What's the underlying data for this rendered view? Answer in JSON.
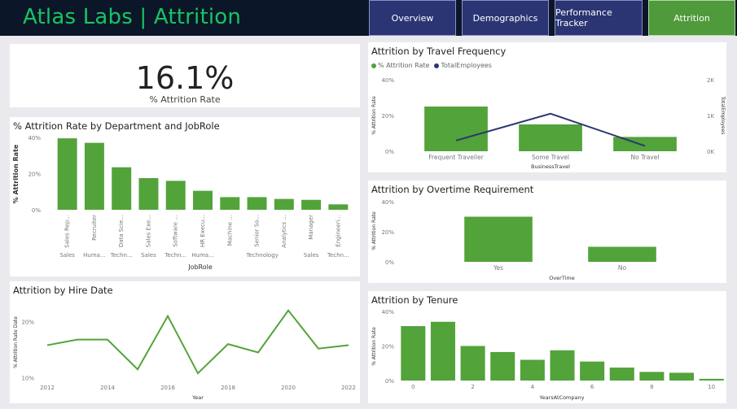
{
  "header": {
    "title": "Atlas Labs | Attrition",
    "nav": [
      {
        "label": "Overview",
        "active": false
      },
      {
        "label": "Demographics",
        "active": false
      },
      {
        "label": "Performance Tracker",
        "active": false
      },
      {
        "label": "Attrition",
        "active": true
      }
    ]
  },
  "kpi": {
    "value": "16.1%",
    "label": "% Attrition Rate"
  },
  "colors": {
    "bar": "#52a33a",
    "line_secondary": "#2c3670",
    "header_bg": "#0b1628",
    "title": "#17c462"
  },
  "dept_chart": {
    "title": "% Attrition Rate by Department and JobRole",
    "chart_data": {
      "type": "bar",
      "categories": [
        "Sales Rep...",
        "Recruiter",
        "Data Scie...",
        "Sales Exe...",
        "Software ...",
        "HR Execu...",
        "Machine ...",
        "Senior So...",
        "Analytics ...",
        "Manager",
        "Engineeri..."
      ],
      "departments": [
        "Sales",
        "Huma...",
        "Techn...",
        "Sales",
        "Techn...",
        "Huma...",
        "",
        "Technology",
        "",
        "Sales",
        "Techn..."
      ],
      "values": [
        39.5,
        37,
        23.5,
        17.5,
        16,
        10.5,
        7,
        7,
        6,
        5.5,
        3
      ],
      "ylabel": "% Attrition Rate",
      "xlabel": "JobRole",
      "yticks": [
        "0%",
        "20%",
        "40%"
      ],
      "ylim": [
        0,
        40
      ]
    }
  },
  "hire_chart": {
    "title": "Attrition by Hire Date",
    "chart_data": {
      "type": "line",
      "x": [
        2012,
        2013,
        2014,
        2015,
        2016,
        2017,
        2018,
        2019,
        2020,
        2021,
        2022
      ],
      "values": [
        15.8,
        16.8,
        16.8,
        11.5,
        21,
        10.8,
        16,
        14.5,
        22,
        15.2,
        15.8
      ],
      "ylabel": "% Attrition Rate Date",
      "xlabel": "Year",
      "xticks": [
        "2012",
        "2014",
        "2016",
        "2018",
        "2020",
        "2022"
      ],
      "yticks": [
        "10%",
        "20%"
      ],
      "ylim": [
        9.5,
        24
      ]
    }
  },
  "travel_chart": {
    "title": "Attrition by Travel Frequency",
    "legend": [
      {
        "label": "% Attrition Rate",
        "color": "#52a33a"
      },
      {
        "label": "TotalEmployees",
        "color": "#2c3670"
      }
    ],
    "chart_data": {
      "type": "bar",
      "categories": [
        "Frequent Traveller",
        "Some Travel",
        "No Travel"
      ],
      "series": [
        {
          "name": "% Attrition Rate",
          "values": [
            25,
            15,
            8
          ]
        },
        {
          "name": "TotalEmployees",
          "values": [
            300,
            1050,
            150
          ]
        }
      ],
      "ylabel": "% Attrition Rate",
      "y2label": "TotalEmployees",
      "xlabel": "BusinessTravel",
      "yticks": [
        "0%",
        "20%",
        "40%"
      ],
      "y2ticks": [
        "0K",
        "1K",
        "2K"
      ],
      "ylim": [
        0,
        40
      ],
      "y2lim": [
        0,
        2000
      ]
    }
  },
  "overtime_chart": {
    "title": "Attrition by Overtime Requirement",
    "chart_data": {
      "type": "bar",
      "categories": [
        "Yes",
        "No"
      ],
      "values": [
        30,
        10
      ],
      "ylabel": "% Attrition Rate",
      "xlabel": "OverTime",
      "yticks": [
        "0%",
        "20%",
        "40%"
      ],
      "ylim": [
        0,
        40
      ]
    }
  },
  "tenure_chart": {
    "title": "Attrition by Tenure",
    "chart_data": {
      "type": "bar",
      "x": [
        0,
        1,
        2,
        3,
        4,
        5,
        6,
        7,
        8,
        9,
        10
      ],
      "values": [
        31.5,
        34,
        20,
        16.5,
        12,
        17.5,
        11,
        7.5,
        5,
        4.5,
        1
      ],
      "ylabel": "% Attrition Rate",
      "xlabel": "YearsAtCompany",
      "xticks": [
        "0",
        "2",
        "4",
        "6",
        "8",
        "10"
      ],
      "yticks": [
        "0%",
        "20%",
        "40%"
      ],
      "ylim": [
        0,
        40
      ]
    }
  }
}
